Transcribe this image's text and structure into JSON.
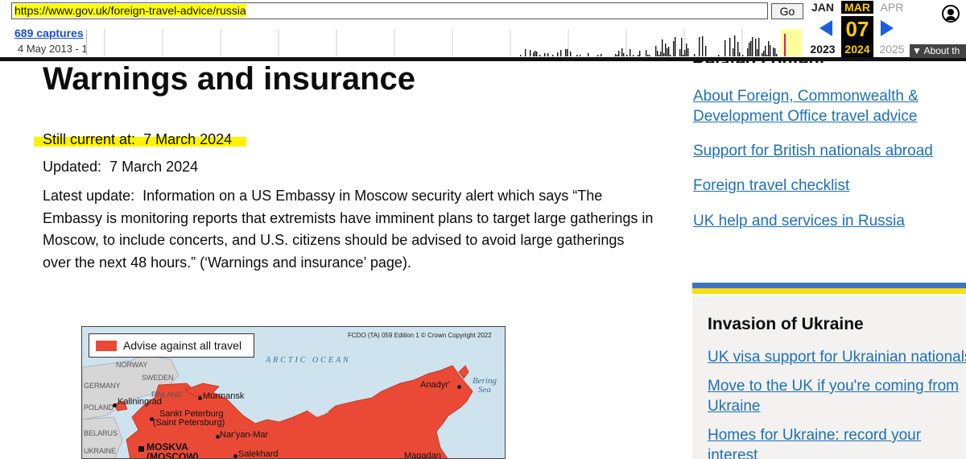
{
  "wayback": {
    "url": "https://www.gov.uk/foreign-travel-advice/russia",
    "go_label": "Go",
    "captures_label": "689 captures",
    "date_range": "4 May 2013 - 1",
    "months": {
      "prev": "JAN",
      "current": "MAR",
      "next": "APR"
    },
    "day": "07",
    "years": {
      "prev": "2023",
      "current": "2024",
      "next": "2025"
    },
    "about_label": "About th",
    "colors": {
      "highlight": "#ffcc00",
      "arrow": "#1a5fe0"
    }
  },
  "page": {
    "title": "Warnings and insurance",
    "still_current_label": "Still current at:",
    "still_current_date": "7 March 2024",
    "updated_label": "Updated:",
    "updated_date": "7 March 2024",
    "latest_update_label": "Latest update:",
    "latest_update_text": "Information on a US Embassy in Moscow security alert which says “The Embassy is monitoring reports that extremists have imminent plans to target large gatherings in Moscow, to include concerts, and U.S. citizens should be advised to avoid large gatherings over the next 48 hours.” (‘Warnings and insurance’ page)."
  },
  "related": {
    "heading": "Related content",
    "links": [
      "About Foreign, Commonwealth & Development Office travel advice",
      "Support for British nationals abroad",
      "Foreign travel checklist",
      "UK help and services in Russia"
    ]
  },
  "ukraine": {
    "title": "Invasion of Ukraine",
    "links": [
      "UK visa support for Ukrainian nationals",
      "Move to the UK if you're coming from Ukraine",
      "Homes for Ukraine: record your interest"
    ],
    "colors": {
      "blue": "#3a75c4",
      "yellow": "#f9dd16"
    }
  },
  "map": {
    "legend_label": "Advise against all travel",
    "legend_color": "#ea4a35",
    "copyright": "FCDO (TA) 059 Edition 1 © Crown Copyright 2022",
    "ocean": "ARCTIC OCEAN",
    "sea": [
      "Bering",
      "Sea"
    ],
    "countries": [
      "NORWAY",
      "SWEDEN",
      "FINLAND",
      "GERMANY",
      "POLAND",
      "BELARUS",
      "UKRAINE"
    ],
    "cities": [
      "Murmansk",
      "Kaliningrad",
      "Sankt Peterburg",
      "(Saint Petersburg)",
      "Nar'yan-Mar",
      "Salekhard",
      "Anadyr'",
      "Magadan"
    ],
    "capital": [
      "MOSKVA",
      "(MOSCOW)"
    ]
  }
}
